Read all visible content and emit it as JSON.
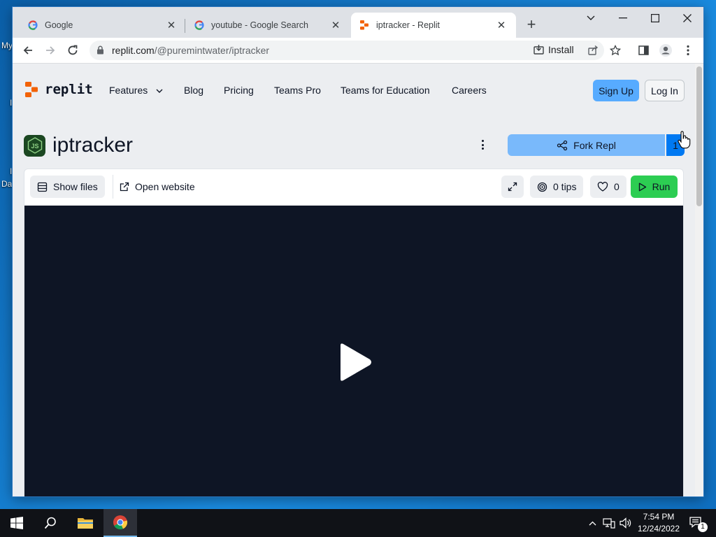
{
  "desktop": {
    "icon_label_1": "My",
    "icon_label_2": "I",
    "icon_label_3": "I",
    "icon_label_4": "Da"
  },
  "browser": {
    "tabs": [
      {
        "title": "Google",
        "favicon": "google-icon"
      },
      {
        "title": "youtube - Google Search",
        "favicon": "google-icon"
      },
      {
        "title": "iptracker - Replit",
        "favicon": "replit-icon"
      }
    ],
    "url_host": "replit.com",
    "url_path": "/@puremintwater/iptracker",
    "install_label": "Install"
  },
  "site": {
    "logo_text": "replit",
    "nav": [
      "Features",
      "Blog",
      "Pricing",
      "Teams Pro",
      "Teams for Education",
      "Careers"
    ],
    "signup_label": "Sign Up",
    "login_label": "Log In"
  },
  "repl": {
    "title": "iptracker",
    "fork_label": "Fork Repl",
    "fork_count": "1",
    "show_files_label": "Show files",
    "open_website_label": "Open website",
    "tips_label": "0 tips",
    "likes": "0",
    "run_label": "Run"
  },
  "taskbar": {
    "time": "7:54 PM",
    "date": "12/24/2022",
    "notification_count": "1"
  },
  "colors": {
    "replit_orange": "#f26207",
    "signup_blue": "#57abff",
    "run_green": "#2ccd52",
    "video_bg": "#0e1525"
  }
}
